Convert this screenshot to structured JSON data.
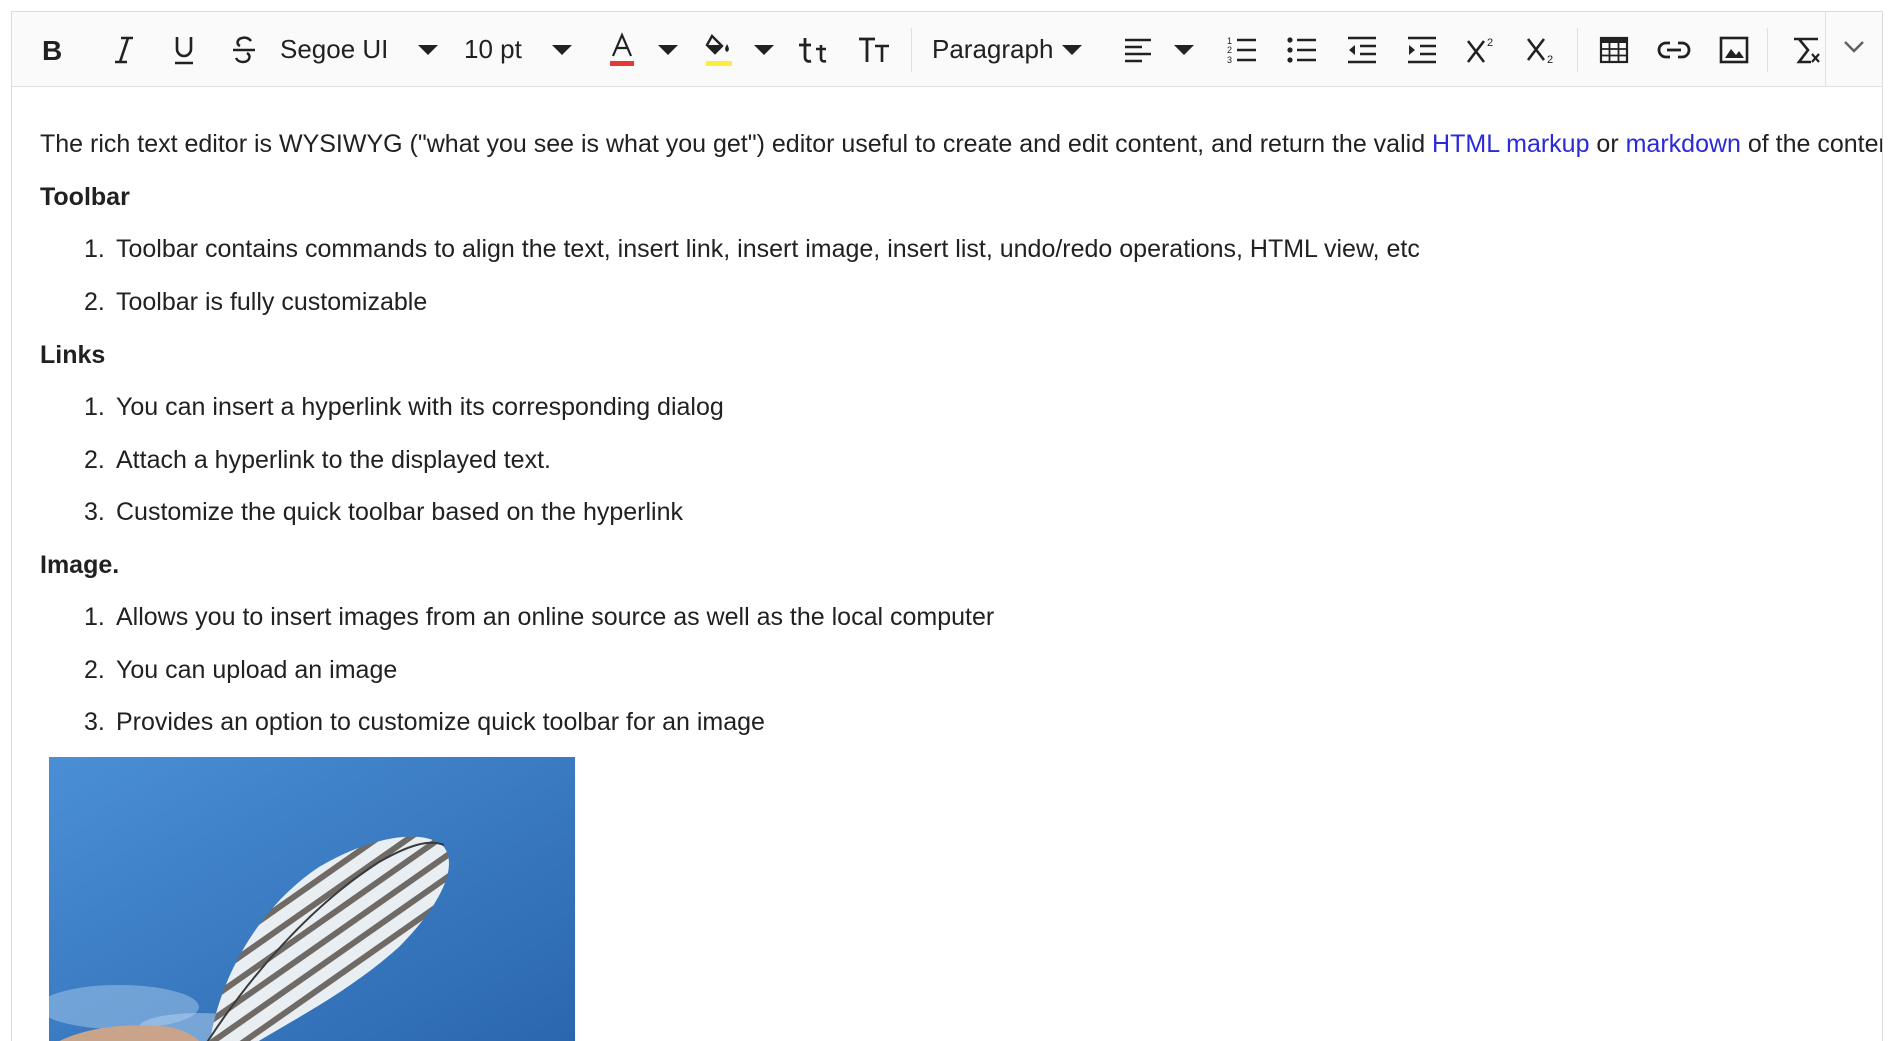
{
  "toolbar": {
    "font_name": "Segoe UI",
    "font_size": "10 pt",
    "format": "Paragraph",
    "colors": {
      "font_color_bar": "#e53935",
      "highlight_bar": "#ffeb3b"
    },
    "icons": [
      "bold-icon",
      "italic-icon",
      "underline-icon",
      "strikethrough-icon",
      "font-color-icon",
      "background-color-icon",
      "lowercase-icon",
      "uppercase-icon",
      "align-left-icon",
      "ordered-list-icon",
      "unordered-list-icon",
      "outdent-icon",
      "indent-icon",
      "superscript-icon",
      "subscript-icon",
      "table-icon",
      "link-icon",
      "image-icon",
      "clear-format-icon",
      "expand-chevron-icon"
    ]
  },
  "content": {
    "intro_before": "The rich text editor is WYSIWYG (\"what you see is what you get\") editor useful to create and edit content, and return the valid ",
    "link1": "HTML markup",
    "intro_mid": " or ",
    "link2": "markdown",
    "intro_after": " of the content",
    "colors": {
      "link": "#2a2ad8"
    },
    "sections": [
      {
        "heading": "Toolbar",
        "items": [
          "Toolbar contains commands to align the text, insert link, insert image, insert list, undo/redo operations, HTML view, etc",
          "Toolbar is fully customizable"
        ]
      },
      {
        "heading": "Links",
        "items": [
          "You can insert a hyperlink with its corresponding dialog",
          "Attach a hyperlink to the displayed text.",
          "Customize the quick toolbar based on the hyperlink"
        ]
      },
      {
        "heading": "Image.",
        "items": [
          "Allows you to insert images from an online source as well as the local computer",
          "You can upload an image",
          "Provides an option to customize quick toolbar for an image"
        ]
      }
    ],
    "numbers": [
      "1.",
      "2.",
      "3."
    ]
  }
}
